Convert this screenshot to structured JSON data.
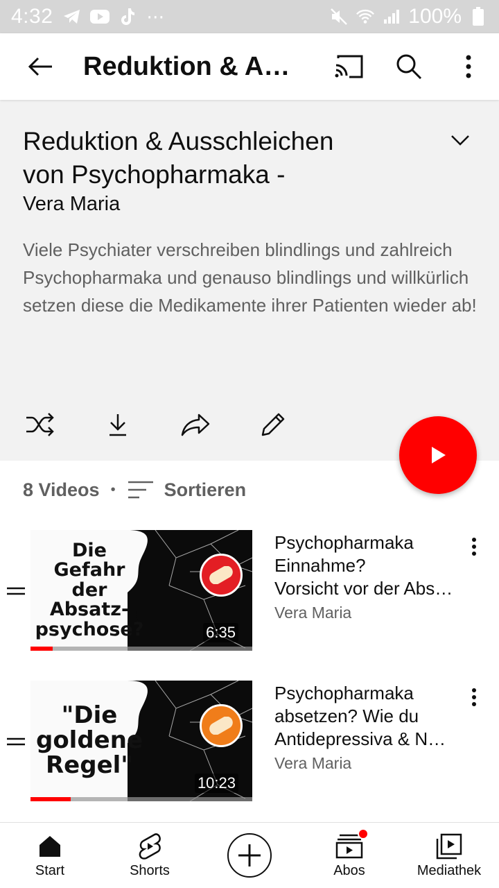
{
  "status_bar": {
    "time": "4:32",
    "battery": "100%"
  },
  "app_bar": {
    "title": "Reduktion & Ausschleichen von Psychopharmaka -"
  },
  "playlist": {
    "title_line1": "Reduktion & Ausschleichen",
    "title_line2": "von Psychopharmaka -",
    "owner": "Vera Maria",
    "description": "Viele Psychiater verschreiben blindlings und zahlreich Psychopharmaka und genauso blindlings und willkürlich setzen diese die Medikamente ihrer Patienten wieder ab!",
    "video_count": "8 Videos",
    "sort_label": "Sortieren"
  },
  "videos": [
    {
      "title_line1": "Psychopharmaka",
      "title_line2": "Einnahme?",
      "title_line3": "Vorsicht vor der Absatzpsychose",
      "channel": "Vera Maria",
      "duration": "6:35",
      "thumb_lines": [
        "Die",
        "Gefahr",
        "der",
        "Absatz-",
        "psychose?"
      ],
      "badge_color": "#e31e24",
      "watched_fraction": 0.1
    },
    {
      "title_line1": "Psychopharmaka",
      "title_line2": "absetzen? Wie du",
      "title_line3": "Antidepressiva & Neuroleptika",
      "channel": "Vera Maria",
      "duration": "10:23",
      "thumb_lines": [
        "\"Die",
        "goldene",
        "Regel\""
      ],
      "badge_color": "#f07d1a",
      "watched_fraction": 0.18
    }
  ],
  "bottom_nav": {
    "start": "Start",
    "shorts": "Shorts",
    "abos": "Abos",
    "mediathek": "Mediathek"
  },
  "colors": {
    "accent": "#ff0000",
    "header_bg": "#f2f2f2",
    "secondary_text": "#606060"
  }
}
